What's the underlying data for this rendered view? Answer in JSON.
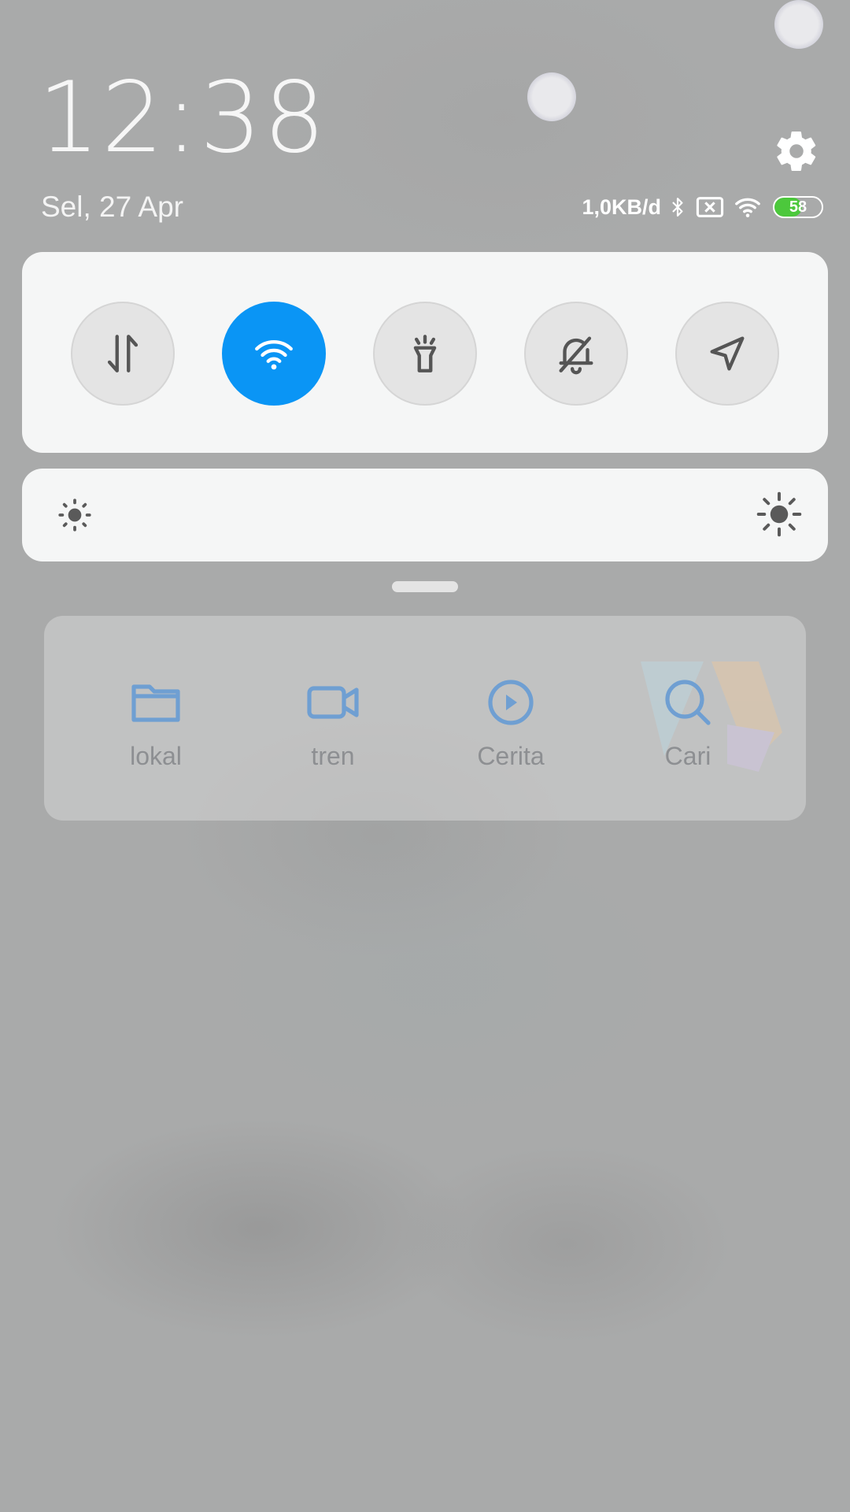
{
  "header": {
    "time": "12:38",
    "date": "Sel, 27 Apr"
  },
  "status_bar": {
    "network_speed": "1,0KB/d",
    "icons": [
      "bluetooth-icon",
      "no-sim-icon",
      "wifi-icon",
      "battery-icon"
    ],
    "battery_level": "58",
    "battery_fill_percent": 58
  },
  "quick_toggles": [
    {
      "id": "mobile-data",
      "icon": "data-transfer-icon",
      "active": false
    },
    {
      "id": "wifi",
      "icon": "wifi-icon",
      "active": true
    },
    {
      "id": "flashlight",
      "icon": "flashlight-icon",
      "active": false
    },
    {
      "id": "silent",
      "icon": "bell-off-icon",
      "active": false
    },
    {
      "id": "location",
      "icon": "location-arrow-icon",
      "active": false
    }
  ],
  "brightness": {
    "min_icon": "sun-small-icon",
    "max_icon": "sun-large-icon"
  },
  "widget_shortcuts": [
    {
      "label": "lokal",
      "icon": "folder-icon"
    },
    {
      "label": "tren",
      "icon": "video-camera-icon"
    },
    {
      "label": "Cerita",
      "icon": "play-circle-icon"
    },
    {
      "label": "Cari",
      "icon": "search-icon"
    }
  ],
  "colors": {
    "accent": "#0a95f5",
    "shortcut_icon": "#6f9fd2",
    "battery_fill": "#4cc83c"
  }
}
